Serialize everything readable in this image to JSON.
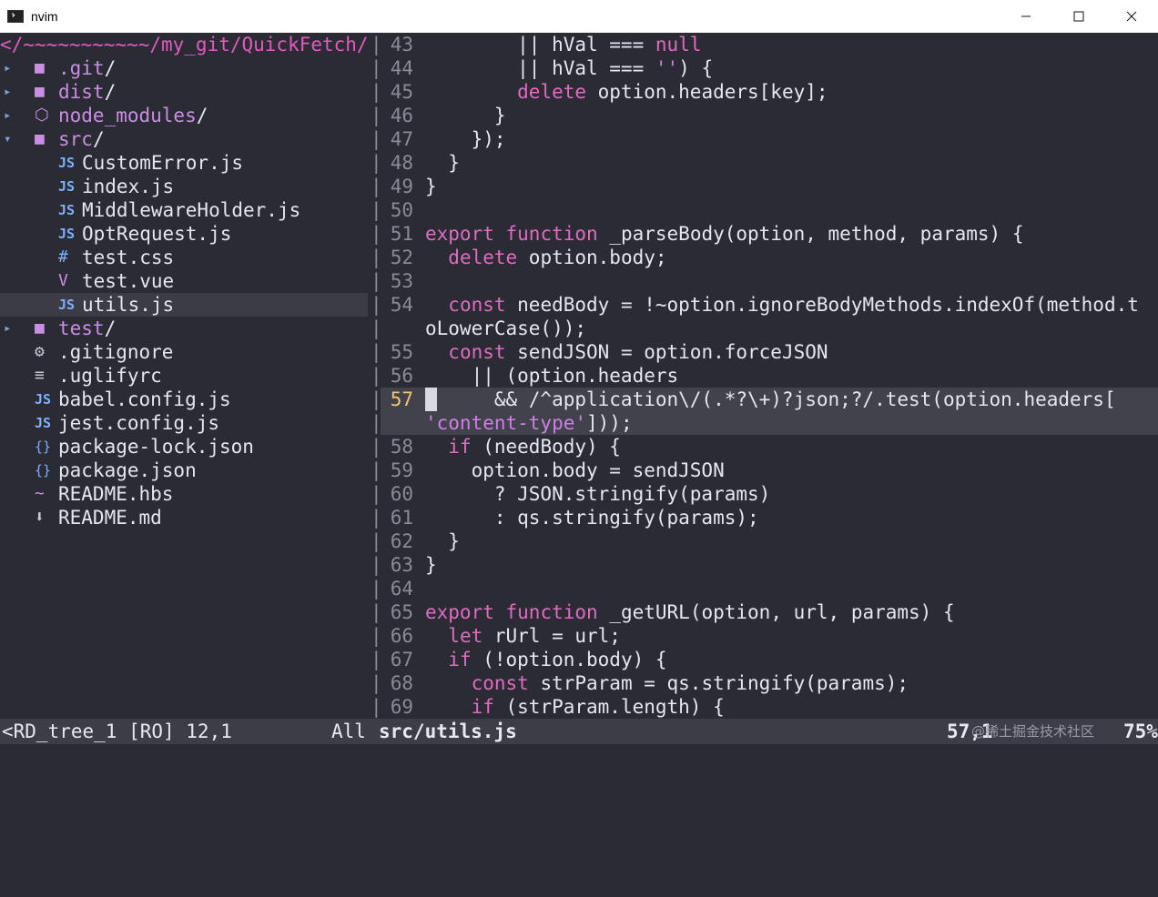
{
  "window": {
    "title": "nvim"
  },
  "tree": {
    "root": "</~~~~~~~~~~~/my_git/QuickFetch/",
    "items": [
      {
        "arrow": "▸",
        "icon": "■",
        "name": ".git",
        "slash": "/",
        "kind": "dir",
        "indent": 0
      },
      {
        "arrow": "▸",
        "icon": "■",
        "name": "dist",
        "slash": "/",
        "kind": "dir",
        "indent": 0
      },
      {
        "arrow": "▸",
        "icon": "⬡",
        "name": "node_modules",
        "slash": "/",
        "kind": "dir",
        "indent": 0
      },
      {
        "arrow": "▾",
        "icon": "■",
        "name": "src",
        "slash": "/",
        "kind": "dir",
        "indent": 0
      },
      {
        "arrow": "",
        "icon": "JS",
        "name": "CustomError.js",
        "slash": "",
        "kind": "file",
        "indent": 1
      },
      {
        "arrow": "",
        "icon": "JS",
        "name": "index.js",
        "slash": "",
        "kind": "file",
        "indent": 1
      },
      {
        "arrow": "",
        "icon": "JS",
        "name": "MiddlewareHolder.js",
        "slash": "",
        "kind": "file",
        "indent": 1
      },
      {
        "arrow": "",
        "icon": "JS",
        "name": "OptRequest.js",
        "slash": "",
        "kind": "file",
        "indent": 1
      },
      {
        "arrow": "",
        "icon": "#",
        "name": "test.css",
        "slash": "",
        "kind": "file",
        "indent": 1
      },
      {
        "arrow": "",
        "icon": "V",
        "name": "test.vue",
        "slash": "",
        "kind": "file",
        "indent": 1
      },
      {
        "arrow": "",
        "icon": "JS",
        "name": "utils.js",
        "slash": "",
        "kind": "file",
        "indent": 1,
        "selected": true
      },
      {
        "arrow": "▸",
        "icon": "■",
        "name": "test",
        "slash": "/",
        "kind": "dir",
        "indent": 0
      },
      {
        "arrow": "",
        "icon": "⚙",
        "name": ".gitignore",
        "slash": "",
        "kind": "file",
        "indent": 0
      },
      {
        "arrow": "",
        "icon": "≡",
        "name": ".uglifyrc",
        "slash": "",
        "kind": "file",
        "indent": 0
      },
      {
        "arrow": "",
        "icon": "JS",
        "name": "babel.config.js",
        "slash": "",
        "kind": "file",
        "indent": 0
      },
      {
        "arrow": "",
        "icon": "JS",
        "name": "jest.config.js",
        "slash": "",
        "kind": "file",
        "indent": 0
      },
      {
        "arrow": "",
        "icon": "{}",
        "name": "package-lock.json",
        "slash": "",
        "kind": "file",
        "indent": 0
      },
      {
        "arrow": "",
        "icon": "{}",
        "name": "package.json",
        "slash": "",
        "kind": "file",
        "indent": 0
      },
      {
        "arrow": "",
        "icon": "~",
        "name": "README.hbs",
        "slash": "",
        "kind": "file",
        "indent": 0
      },
      {
        "arrow": "",
        "icon": "⬇",
        "name": "README.md",
        "slash": "",
        "kind": "file",
        "indent": 0
      }
    ]
  },
  "code": {
    "lines": [
      {
        "n": "43",
        "t": [
          [
            "",
            "        || hVal === "
          ],
          [
            "kw",
            "null"
          ]
        ]
      },
      {
        "n": "44",
        "t": [
          [
            "",
            "        || hVal === "
          ],
          [
            "str",
            "''"
          ],
          [
            "",
            ") {"
          ]
        ]
      },
      {
        "n": "45",
        "t": [
          [
            "",
            "        "
          ],
          [
            "kw",
            "delete"
          ],
          [
            "",
            " option.headers[key];"
          ]
        ]
      },
      {
        "n": "46",
        "t": [
          [
            "",
            "      }"
          ]
        ]
      },
      {
        "n": "47",
        "t": [
          [
            "",
            "    });"
          ]
        ]
      },
      {
        "n": "48",
        "t": [
          [
            "",
            "  }"
          ]
        ]
      },
      {
        "n": "49",
        "t": [
          [
            "",
            "}"
          ]
        ]
      },
      {
        "n": "50",
        "t": [
          [
            "",
            ""
          ]
        ]
      },
      {
        "n": "51",
        "t": [
          [
            "kw",
            "export"
          ],
          [
            "",
            " "
          ],
          [
            "kw",
            "function"
          ],
          [
            "",
            " _parseBody(option, method, params) {"
          ]
        ]
      },
      {
        "n": "52",
        "t": [
          [
            "",
            "  "
          ],
          [
            "kw",
            "delete"
          ],
          [
            "",
            " option.body;"
          ]
        ]
      },
      {
        "n": "53",
        "t": [
          [
            "",
            ""
          ]
        ]
      },
      {
        "n": "54",
        "t": [
          [
            "",
            "  "
          ],
          [
            "kw",
            "const"
          ],
          [
            "",
            " needBody = !~option.ignoreBodyMethods.indexOf(method.t"
          ]
        ]
      },
      {
        "n": "",
        "t": [
          [
            "",
            "oLowerCase());"
          ]
        ]
      },
      {
        "n": "55",
        "t": [
          [
            "",
            "  "
          ],
          [
            "kw",
            "const"
          ],
          [
            "",
            " sendJSON = option.forceJSON"
          ]
        ]
      },
      {
        "n": "56",
        "t": [
          [
            "",
            "    || (option.headers"
          ]
        ]
      },
      {
        "n": "57",
        "cur": true,
        "t": [
          [
            "",
            "      && /^application\\/(.*?\\+)?json;?/.test(option.headers["
          ]
        ]
      },
      {
        "n": "",
        "cur": true,
        "t": [
          [
            "str",
            "'content-type'"
          ],
          [
            "",
            "]));"
          ]
        ]
      },
      {
        "n": "58",
        "t": [
          [
            "",
            "  "
          ],
          [
            "kw",
            "if"
          ],
          [
            "",
            " (needBody) {"
          ]
        ]
      },
      {
        "n": "59",
        "t": [
          [
            "",
            "    option.body = sendJSON"
          ]
        ]
      },
      {
        "n": "60",
        "t": [
          [
            "",
            "      ? JSON.stringify(params)"
          ]
        ]
      },
      {
        "n": "61",
        "t": [
          [
            "",
            "      : qs.stringify(params);"
          ]
        ]
      },
      {
        "n": "62",
        "t": [
          [
            "",
            "  }"
          ]
        ]
      },
      {
        "n": "63",
        "t": [
          [
            "",
            "}"
          ]
        ]
      },
      {
        "n": "64",
        "t": [
          [
            "",
            ""
          ]
        ]
      },
      {
        "n": "65",
        "t": [
          [
            "kw",
            "export"
          ],
          [
            "",
            " "
          ],
          [
            "kw",
            "function"
          ],
          [
            "",
            " _getURL(option, url, params) {"
          ]
        ]
      },
      {
        "n": "66",
        "t": [
          [
            "",
            "  "
          ],
          [
            "kw",
            "let"
          ],
          [
            "",
            " rUrl = url;"
          ]
        ]
      },
      {
        "n": "67",
        "t": [
          [
            "",
            "  "
          ],
          [
            "kw",
            "if"
          ],
          [
            "",
            " (!option.body) {"
          ]
        ]
      },
      {
        "n": "68",
        "t": [
          [
            "",
            "    "
          ],
          [
            "kw",
            "const"
          ],
          [
            "",
            " strParam = qs.stringify(params);"
          ]
        ]
      },
      {
        "n": "69",
        "t": [
          [
            "",
            "    "
          ],
          [
            "kw",
            "if"
          ],
          [
            "",
            " (strParam.length) {"
          ]
        ]
      }
    ]
  },
  "status": {
    "left": "<RD_tree_1 [RO] 12,1",
    "all": "All",
    "file": "src/utils.js",
    "pos": "57,1",
    "percent": "75%",
    "watermark": "@稀土掘金技术社区"
  }
}
